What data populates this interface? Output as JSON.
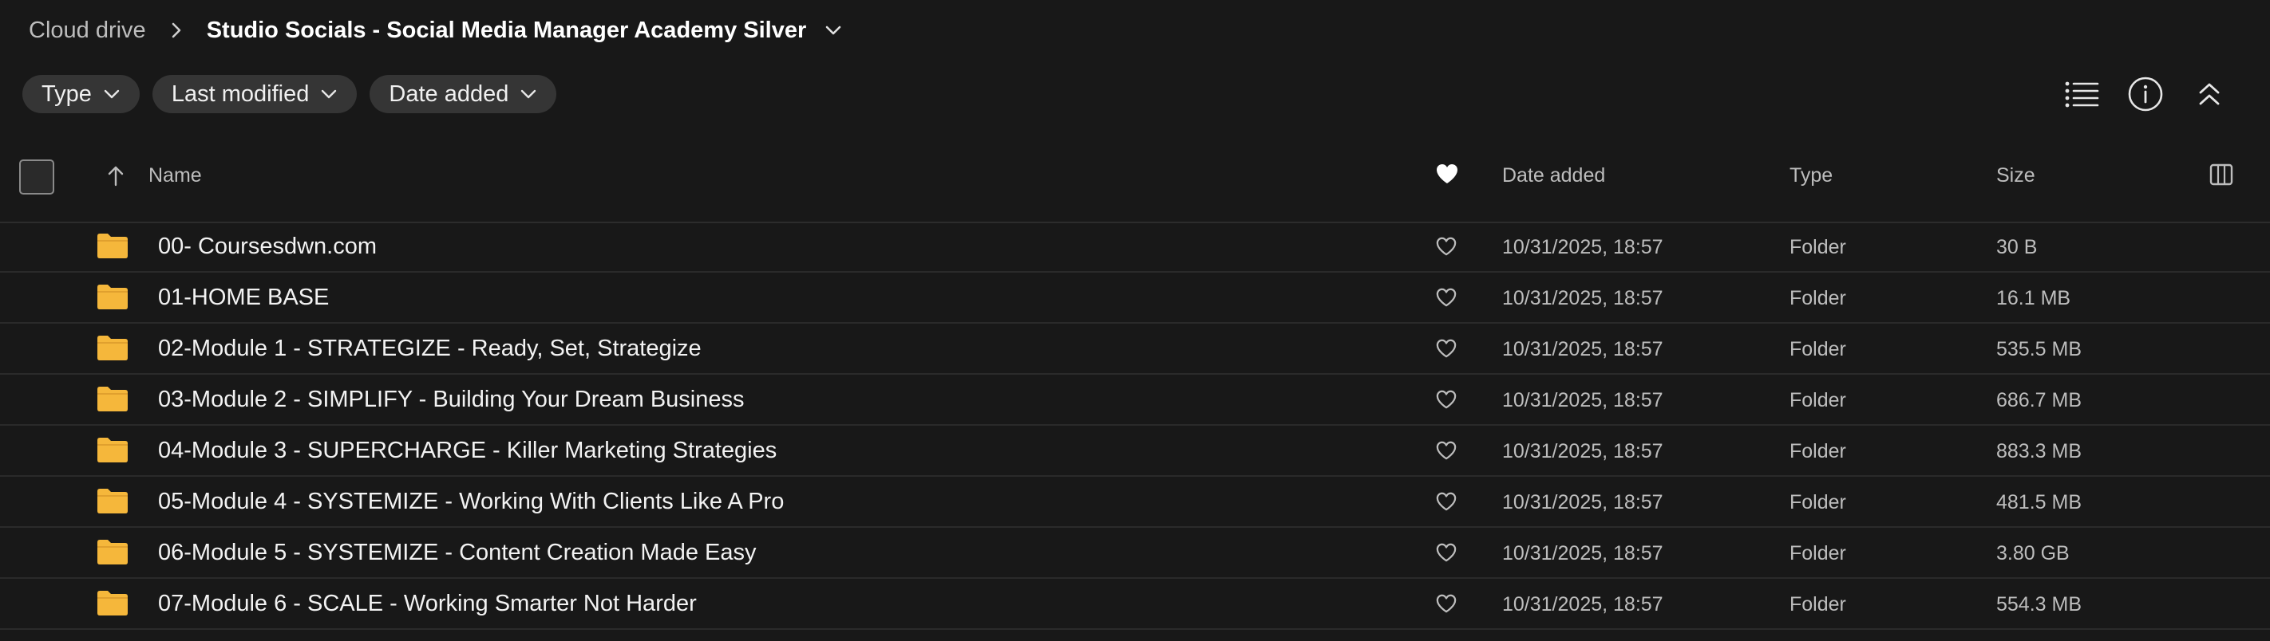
{
  "breadcrumb": {
    "root": "Cloud drive",
    "current": "Studio Socials - Social Media Manager Academy Silver"
  },
  "filters": {
    "type_label": "Type",
    "modified_label": "Last modified",
    "added_label": "Date added"
  },
  "columns": {
    "name": "Name",
    "date_added": "Date added",
    "type": "Type",
    "size": "Size"
  },
  "rows": [
    {
      "name": "00- Coursesdwn.com",
      "date": "10/31/2025, 18:57",
      "type": "Folder",
      "size": "30 B"
    },
    {
      "name": "01-HOME BASE",
      "date": "10/31/2025, 18:57",
      "type": "Folder",
      "size": "16.1 MB"
    },
    {
      "name": "02-Module 1 - STRATEGIZE - Ready, Set, Strategize",
      "date": "10/31/2025, 18:57",
      "type": "Folder",
      "size": "535.5 MB"
    },
    {
      "name": "03-Module 2 - SIMPLIFY - Building Your Dream Business",
      "date": "10/31/2025, 18:57",
      "type": "Folder",
      "size": "686.7 MB"
    },
    {
      "name": "04-Module 3 - SUPERCHARGE - Killer Marketing Strategies",
      "date": "10/31/2025, 18:57",
      "type": "Folder",
      "size": "883.3 MB"
    },
    {
      "name": "05-Module 4 - SYSTEMIZE - Working With Clients Like A Pro",
      "date": "10/31/2025, 18:57",
      "type": "Folder",
      "size": "481.5 MB"
    },
    {
      "name": "06-Module 5 - SYSTEMIZE - Content Creation Made Easy",
      "date": "10/31/2025, 18:57",
      "type": "Folder",
      "size": "3.80 GB"
    },
    {
      "name": "07-Module 6 - SCALE - Working Smarter Not Harder",
      "date": "10/31/2025, 18:57",
      "type": "Folder",
      "size": "554.3 MB"
    }
  ],
  "colors": {
    "background": "#181818",
    "chip": "#353535",
    "folder": "#f5b73b",
    "text_primary": "#f2f2f2",
    "text_secondary": "#bdbdbd"
  },
  "icons": {
    "breadcrumb_separator": "chevron-right-icon",
    "breadcrumb_dropdown": "chevron-down-icon",
    "list_view": "list-view-icon",
    "info": "info-icon",
    "collapse": "chevrons-up-icon",
    "favorite": "heart-icon",
    "folder": "folder-icon",
    "sort": "arrow-up-icon",
    "column_picker": "columns-icon"
  }
}
